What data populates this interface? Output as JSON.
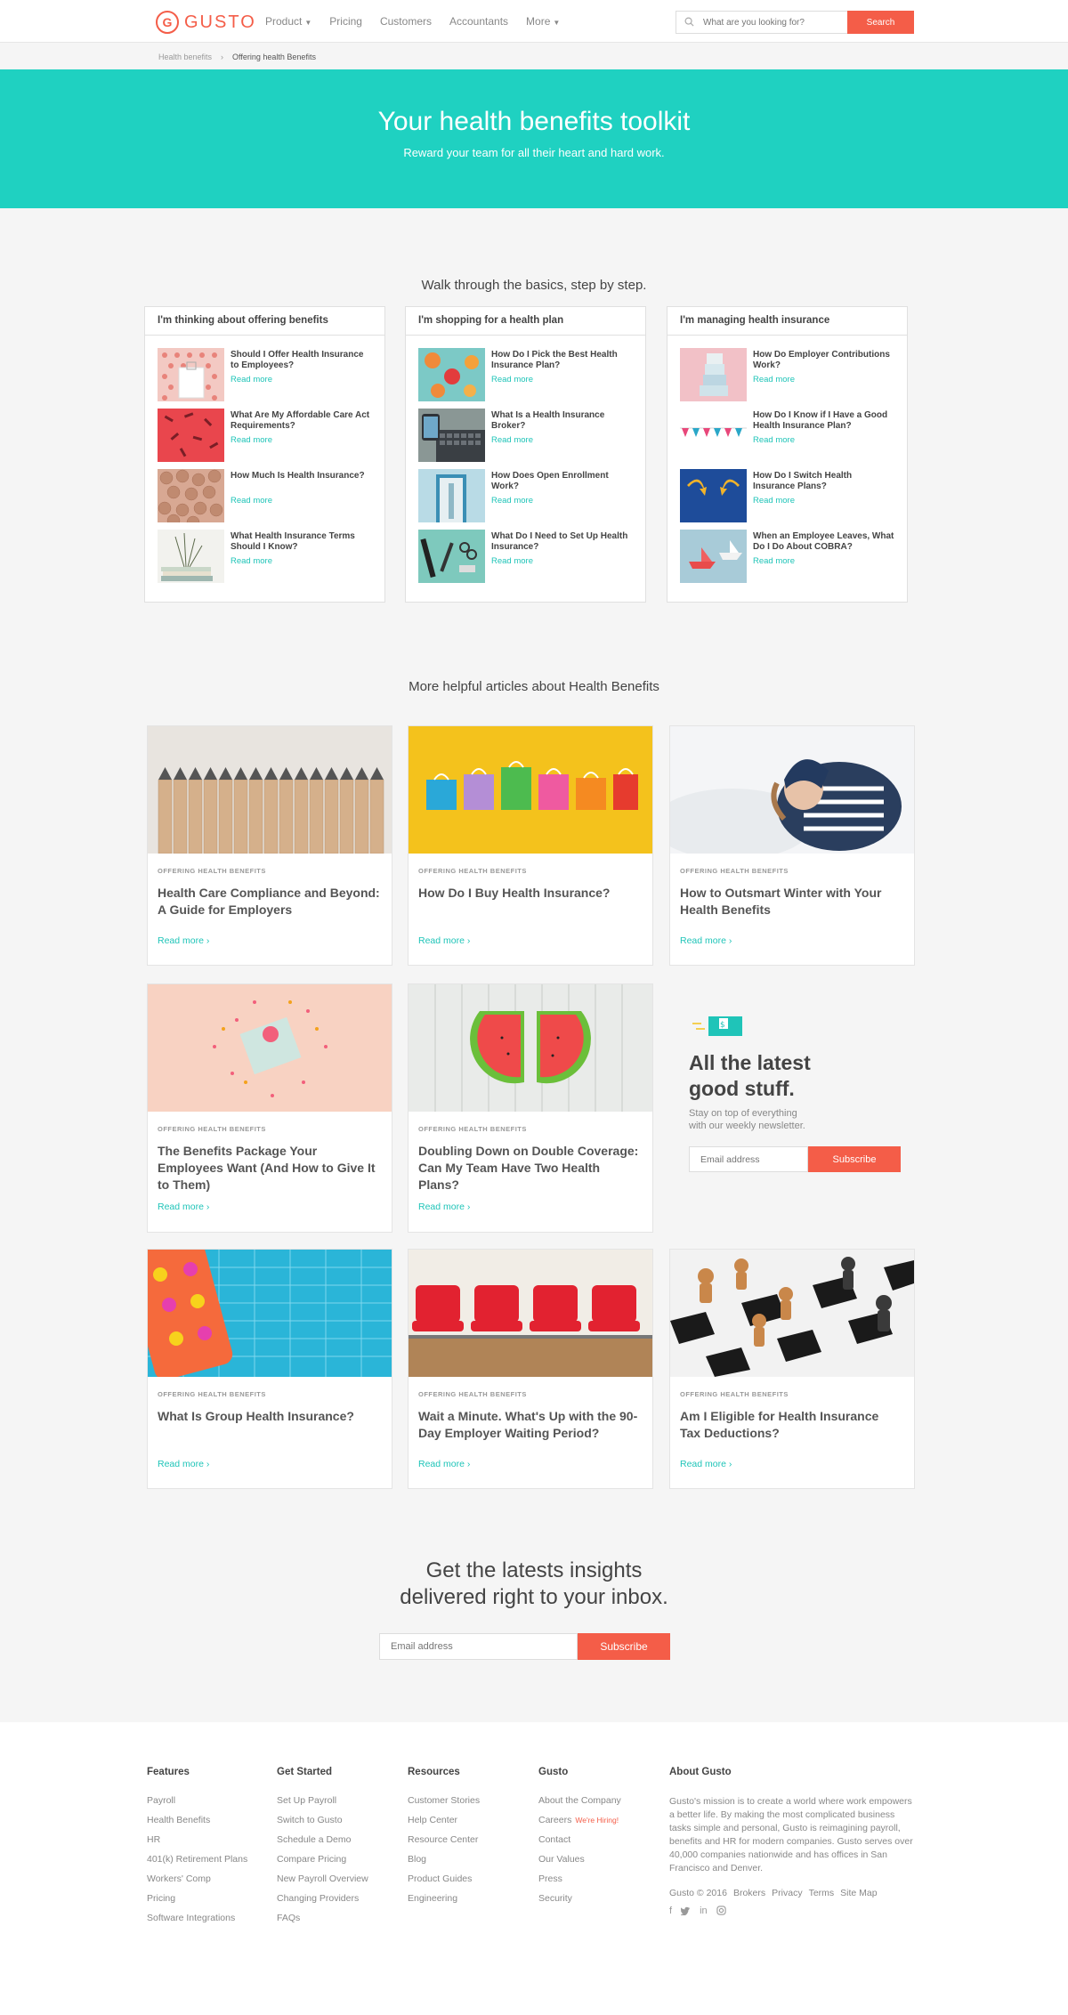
{
  "header": {
    "logo_text": "GUSTO",
    "nav": [
      {
        "label": "Product",
        "has_caret": true
      },
      {
        "label": "Pricing"
      },
      {
        "label": "Customers"
      },
      {
        "label": "Accountants"
      },
      {
        "label": "More",
        "has_caret": true
      }
    ],
    "search_placeholder": "What are you looking for?",
    "search_button": "Search"
  },
  "breadcrumb": {
    "parent": "Health benefits",
    "separator": "›",
    "current": "Offering health Benefits"
  },
  "hero": {
    "title": "Your health benefits toolkit",
    "subtitle": "Reward your team for all their heart and hard work."
  },
  "toolkit": {
    "title": "Walk through the basics, step by step.",
    "columns": [
      {
        "heading": "I'm thinking about offering benefits",
        "items": [
          {
            "title": "Should I Offer Health Insurance to Employees?",
            "link": "Read more"
          },
          {
            "title": "What Are My Affordable Care Act Requirements?",
            "link": "Read more"
          },
          {
            "title": "How Much Is Health Insurance?",
            "link": "Read more"
          },
          {
            "title": "What Health Insurance Terms Should I Know?",
            "link": "Read more"
          }
        ]
      },
      {
        "heading": "I'm shopping for a health plan",
        "items": [
          {
            "title": "How Do I Pick the Best Health Insurance Plan?",
            "link": "Read more"
          },
          {
            "title": "What Is a Health Insurance Broker?",
            "link": "Read more"
          },
          {
            "title": "How Does Open Enrollment Work?",
            "link": "Read more"
          },
          {
            "title": "What Do I Need to Set Up Health Insurance?",
            "link": "Read more"
          }
        ]
      },
      {
        "heading": "I'm managing health insurance",
        "items": [
          {
            "title": "How Do Employer Contributions Work?",
            "link": "Read more"
          },
          {
            "title": "How Do I Know if I Have a Good Health Insurance Plan?",
            "link": "Read more"
          },
          {
            "title": "How Do I Switch Health Insurance Plans?",
            "link": "Read more"
          },
          {
            "title": "When an Employee Leaves, What Do I Do About COBRA?",
            "link": "Read more"
          }
        ]
      }
    ]
  },
  "articles": {
    "title": "More helpful articles about Health Benefits",
    "category": "OFFERING HEALTH BENEFITS",
    "read_more": "Read more",
    "items": [
      {
        "title": "Health Care Compliance and Beyond: A Guide for Employers"
      },
      {
        "title": "How Do I Buy Health Insurance?"
      },
      {
        "title": "How to Outsmart Winter with Your Health Benefits"
      },
      {
        "title": "The Benefits Package Your Employees Want (And How to Give It to Them)"
      },
      {
        "title": "Doubling Down on Double Coverage: Can My Team Have Two Health Plans?"
      },
      {
        "title": "What Is Group Health Insurance?"
      },
      {
        "title": "Wait a Minute. What's Up with the 90-Day Employer Waiting Period?"
      },
      {
        "title": "Am I Eligible for Health Insurance Tax Deductions?"
      }
    ]
  },
  "newsletter": {
    "title_line1": "All the latest",
    "title_line2": "good stuff.",
    "text_line1": "Stay on top of everything",
    "text_line2": "with our weekly newsletter.",
    "placeholder": "Email address",
    "button": "Subscribe"
  },
  "cta": {
    "line1": "Get the latests insights",
    "line2": "delivered right to your inbox.",
    "placeholder": "Email address",
    "button": "Subscribe"
  },
  "footer": {
    "columns": [
      {
        "heading": "Features",
        "links": [
          "Payroll",
          "Health Benefits",
          "HR",
          "401(k) Retirement Plans",
          "Workers' Comp",
          "Pricing",
          "Software Integrations"
        ]
      },
      {
        "heading": "Get Started",
        "links": [
          "Set Up Payroll",
          "Switch to Gusto",
          "Schedule a Demo",
          "Compare Pricing",
          "New Payroll Overview",
          "Changing Providers",
          "FAQs"
        ]
      },
      {
        "heading": "Resources",
        "links": [
          "Customer Stories",
          "Help Center",
          "Resource Center",
          "Blog",
          "Product Guides",
          "Engineering"
        ]
      },
      {
        "heading": "Gusto",
        "links": [
          "About the Company",
          "Careers",
          "Contact",
          "Our Values",
          "Press",
          "Security"
        ],
        "hiring": "We're Hiring!"
      }
    ],
    "about": {
      "heading": "About Gusto",
      "text": "Gusto's mission is to create a world where work empowers a better life. By making the most complicated business tasks simple and personal, Gusto is reimagining payroll, benefits and HR for modern companies. Gusto serves over 40,000 companies nationwide and has offices in San Francisco and Denver.",
      "legal": [
        "Gusto © 2016",
        "Brokers",
        "Privacy",
        "Terms",
        "Site Map"
      ],
      "social": [
        "facebook-icon",
        "twitter-icon",
        "linkedin-icon",
        "instagram-icon"
      ]
    }
  },
  "colors": {
    "brand": "#f45d48",
    "teal": "#1fd1c1",
    "link": "#1fc4b8"
  }
}
